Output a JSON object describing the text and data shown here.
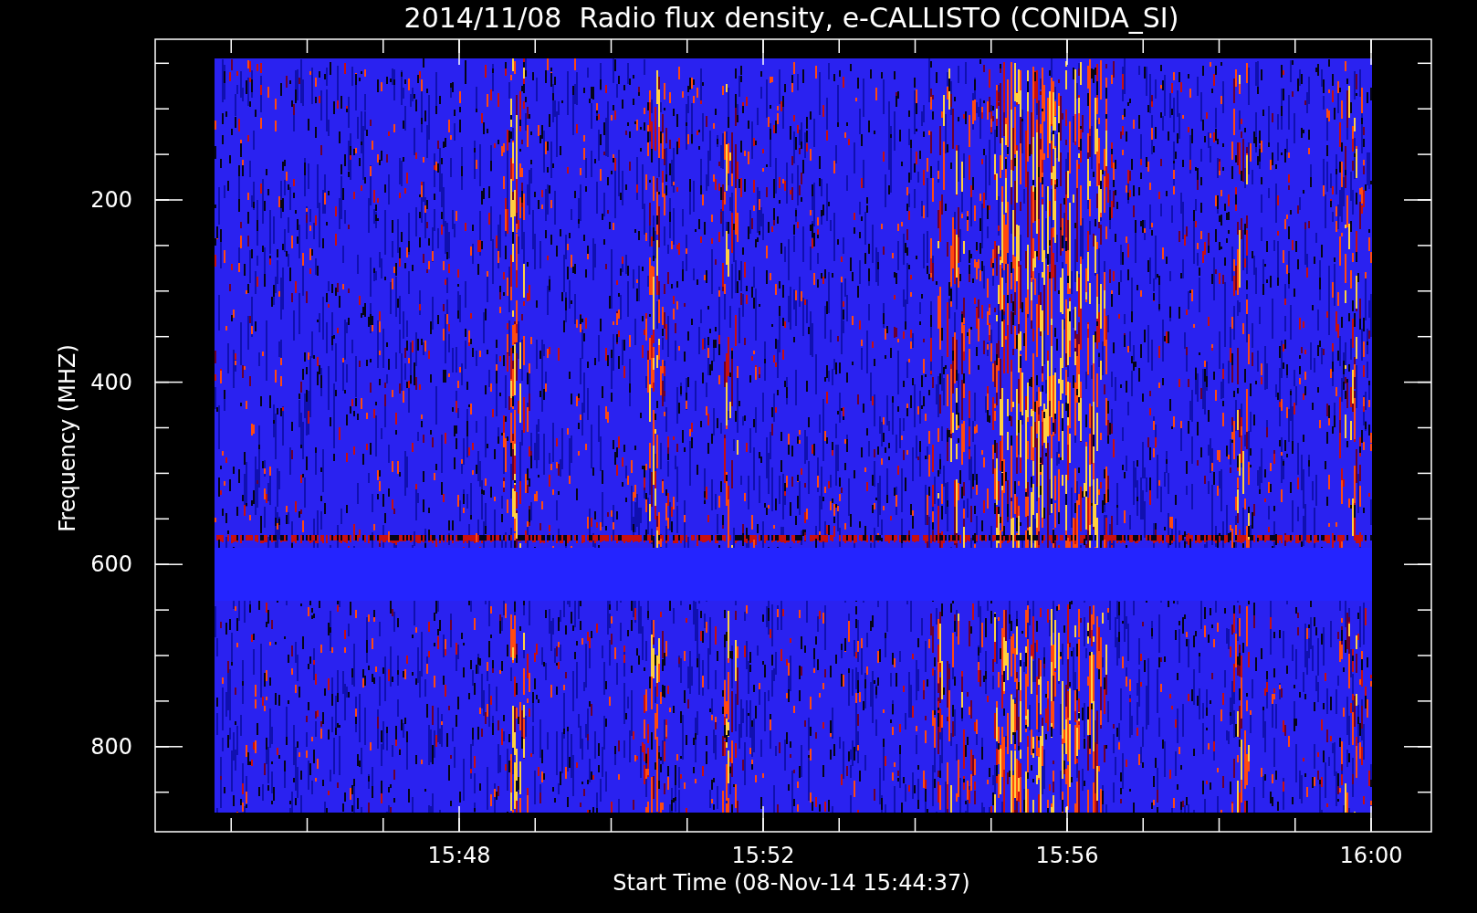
{
  "title": "2014/11/08  Radio flux density, e-CALLISTO (CONIDA_SI)",
  "y_axis": {
    "label": "Frequency (MHZ)",
    "tick_labels": [
      "200",
      "400",
      "600",
      "800"
    ]
  },
  "x_axis": {
    "label": "Start Time (08-Nov-14 15:44:37)",
    "tick_labels": [
      "15:48",
      "15:52",
      "15:56",
      "16:00"
    ]
  }
}
